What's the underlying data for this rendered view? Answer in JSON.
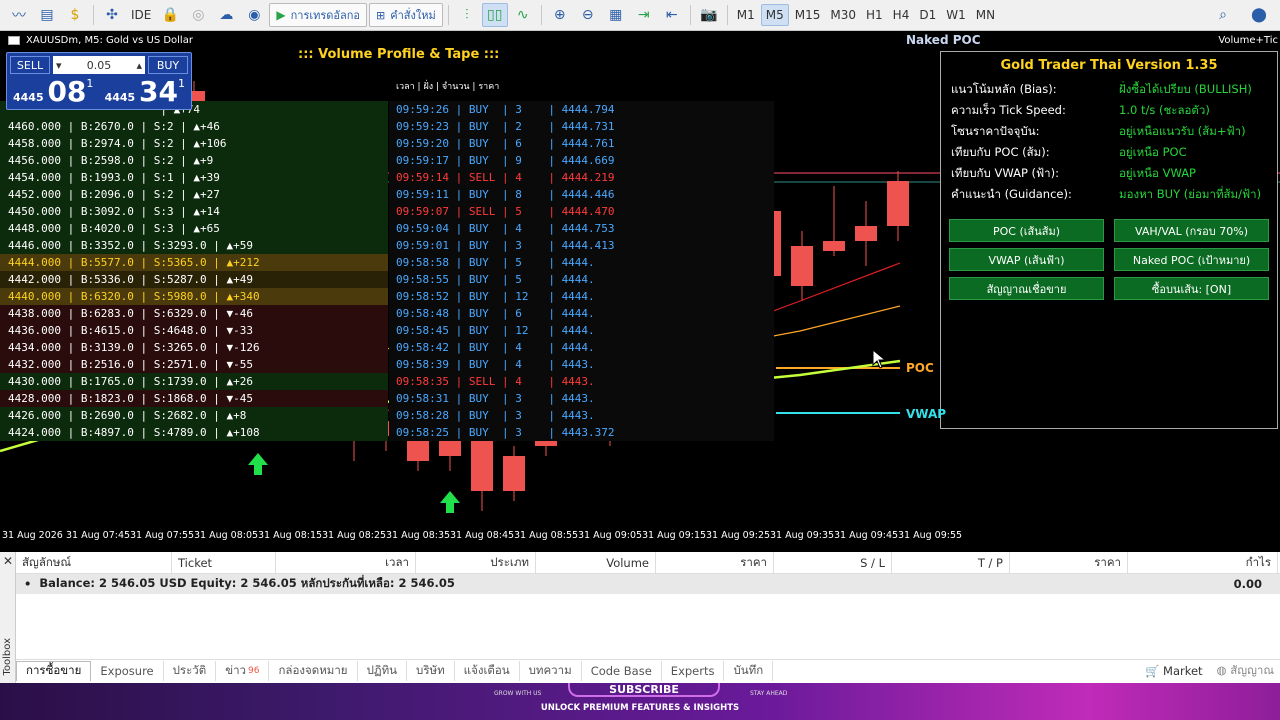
{
  "toolbar": {
    "algo_label": "การเทรดอัลกอ",
    "new_order_label": "คำสั่งใหม่",
    "ide_label": "IDE",
    "timeframes": [
      "M1",
      "M5",
      "M15",
      "M30",
      "H1",
      "H4",
      "D1",
      "W1",
      "MN"
    ],
    "active_timeframe": "M5"
  },
  "chart": {
    "title": "XAUUSDm, M5:  Gold vs US Dollar",
    "right_label": "Volume+Tic",
    "naked_poc_label": "Naked POC",
    "poc_label": "POC",
    "vwap_label": "VWAP",
    "time_labels": [
      "31 Aug 2026",
      "31 Aug 07:45",
      "31 Aug 07:55",
      "31 Aug 08:05",
      "31 Aug 08:15",
      "31 Aug 08:25",
      "31 Aug 08:35",
      "31 Aug 08:45",
      "31 Aug 08:55",
      "31 Aug 09:05",
      "31 Aug 09:15",
      "31 Aug 09:25",
      "31 Aug 09:35",
      "31 Aug 09:45",
      "31 Aug 09:55"
    ]
  },
  "trade_panel": {
    "sell_label": "SELL",
    "buy_label": "BUY",
    "lot": "0.05",
    "bid_prefix": "4445",
    "bid_main": "08",
    "bid_sup": "1",
    "ask_prefix": "4445",
    "ask_main": "34",
    "ask_sup": "1"
  },
  "volume_profile": {
    "title": "::: Volume Profile & Tape :::",
    "rows": [
      {
        "text": "                       | ▲+74",
        "bg": "#0c2a0c",
        "color": "#fff"
      },
      {
        "text": "4460.000 | B:2670.0 | S:2 | ▲+46",
        "bg": "#0c2a0c",
        "color": "#fff"
      },
      {
        "text": "4458.000 | B:2974.0 | S:2 | ▲+106",
        "bg": "#0c2a0c",
        "color": "#fff"
      },
      {
        "text": "4456.000 | B:2598.0 | S:2 | ▲+9",
        "bg": "#0c2a0c",
        "color": "#fff"
      },
      {
        "text": "4454.000 | B:1993.0 | S:1 | ▲+39",
        "bg": "#0c2a0c",
        "color": "#fff"
      },
      {
        "text": "4452.000 | B:2096.0 | S:2 | ▲+27",
        "bg": "#0c2a0c",
        "color": "#fff"
      },
      {
        "text": "4450.000 | B:3092.0 | S:3 | ▲+14",
        "bg": "#0c2a0c",
        "color": "#fff"
      },
      {
        "text": "4448.000 | B:4020.0 | S:3 | ▲+65",
        "bg": "#0c2a0c",
        "color": "#fff"
      },
      {
        "text": "4446.000 | B:3352.0 | S:3293.0 | ▲+59",
        "bg": "#0c2a0c",
        "color": "#fff"
      },
      {
        "text": "4444.000 | B:5577.0 | S:5365.0 | ▲+212",
        "bg": "#4a3a0c",
        "color": "#ffd21f"
      },
      {
        "text": "4442.000 | B:5336.0 | S:5287.0 | ▲+49",
        "bg": "#2a2206",
        "color": "#fff"
      },
      {
        "text": "4440.000 | B:6320.0 | S:5980.0 | ▲+340",
        "bg": "#4a3a0c",
        "color": "#ffd21f"
      },
      {
        "text": "4438.000 | B:6283.0 | S:6329.0 | ▼-46",
        "bg": "#2a0c0c",
        "color": "#fff"
      },
      {
        "text": "4436.000 | B:4615.0 | S:4648.0 | ▼-33",
        "bg": "#2a0c0c",
        "color": "#fff"
      },
      {
        "text": "4434.000 | B:3139.0 | S:3265.0 | ▼-126",
        "bg": "#2a0c0c",
        "color": "#fff"
      },
      {
        "text": "4432.000 | B:2516.0 | S:2571.0 | ▼-55",
        "bg": "#2a0c0c",
        "color": "#fff"
      },
      {
        "text": "4430.000 | B:1765.0 | S:1739.0 | ▲+26",
        "bg": "#0c2a0c",
        "color": "#fff"
      },
      {
        "text": "4428.000 | B:1823.0 | S:1868.0 | ▼-45",
        "bg": "#2a0c0c",
        "color": "#fff"
      },
      {
        "text": "4426.000 | B:2690.0 | S:2682.0 | ▲+8",
        "bg": "#0c2a0c",
        "color": "#fff"
      },
      {
        "text": "4424.000 | B:4897.0 | S:4789.0 | ▲+108",
        "bg": "#0c2a0c",
        "color": "#fff"
      }
    ]
  },
  "tape": {
    "header": "เวลา  | ฝั่ง  | จำนวน  | ราคา",
    "rows": [
      {
        "text": "09:59:26 | BUY  | 3    | 4444.794",
        "side": "buy"
      },
      {
        "text": "09:59:23 | BUY  | 2    | 4444.731",
        "side": "buy"
      },
      {
        "text": "09:59:20 | BUY  | 6    | 4444.761",
        "side": "buy"
      },
      {
        "text": "09:59:17 | BUY  | 9    | 4444.669",
        "side": "buy"
      },
      {
        "text": "09:59:14 | SELL | 4    | 4444.219",
        "side": "sell"
      },
      {
        "text": "09:59:11 | BUY  | 8    | 4444.446",
        "side": "buy"
      },
      {
        "text": "09:59:07 | SELL | 5    | 4444.470",
        "side": "sell"
      },
      {
        "text": "09:59:04 | BUY  | 4    | 4444.753",
        "side": "buy"
      },
      {
        "text": "09:59:01 | BUY  | 3    | 4444.413",
        "side": "buy"
      },
      {
        "text": "09:58:58 | BUY  | 5    | 4444.",
        "side": "buy"
      },
      {
        "text": "09:58:55 | BUY  | 5    | 4444.",
        "side": "buy"
      },
      {
        "text": "09:58:52 | BUY  | 12   | 4444.",
        "side": "buy"
      },
      {
        "text": "09:58:48 | BUY  | 6    | 4444.",
        "side": "buy"
      },
      {
        "text": "09:58:45 | BUY  | 12   | 4444.",
        "side": "buy"
      },
      {
        "text": "09:58:42 | BUY  | 4    | 4444.",
        "side": "buy"
      },
      {
        "text": "09:58:39 | BUY  | 4    | 4443.",
        "side": "buy"
      },
      {
        "text": "09:58:35 | SELL | 4    | 4443.",
        "side": "sell"
      },
      {
        "text": "09:58:31 | BUY  | 3    | 4443.",
        "side": "buy"
      },
      {
        "text": "09:58:28 | BUY  | 3    | 4443.",
        "side": "buy"
      },
      {
        "text": "09:58:25 | BUY  | 3    | 4443.372",
        "side": "buy"
      }
    ]
  },
  "gold_panel": {
    "title": "Gold Trader Thai Version 1.35",
    "rows": [
      {
        "k": "แนวโน้มหลัก (Bias):",
        "v": "ฝั่งซื้อได้เปรียบ (BULLISH)"
      },
      {
        "k": "ความเร็ว Tick Speed:",
        "v": "1.0 t/s (ชะลอตัว)"
      },
      {
        "k": "โซนราคาปัจจุบัน:",
        "v": "อยู่เหนือแนวรับ (ส้ม+ฟ้า)"
      },
      {
        "k": "เทียบกับ POC (ส้ม):",
        "v": "อยู่เหนือ POC"
      },
      {
        "k": "เทียบกับ VWAP (ฟ้า):",
        "v": "อยู่เหนือ VWAP"
      },
      {
        "k": "คำแนะนำ (Guidance):",
        "v": "มองหา BUY (ย่อมาที่ส้ม/ฟ้า)"
      }
    ],
    "buttons": [
      "POC (เส้นส้ม)",
      "VAH/VAL (กรอบ 70%)",
      "VWAP (เส้นฟ้า)",
      "Naked POC (เป้าหมาย)",
      "สัญญาณเชื่อขาย",
      "ซื้อบนเส้น: [ON]"
    ]
  },
  "toolbox": {
    "side_label": "Toolbox",
    "columns": [
      "สัญลักษณ์",
      "Ticket",
      "เวลา",
      "ประเภท",
      "Volume",
      "ราคา",
      "S / L",
      "T / P",
      "ราคา",
      "กำไร"
    ],
    "balance_text": "Balance: 2 546.05 USD  Equity: 2 546.05  หลักประกันที่เหลือ: 2 546.05",
    "profit": "0.00",
    "tabs": [
      "การซื้อขาย",
      "Exposure",
      "ประวัติ",
      "ข่าว",
      "กล่องจดหมาย",
      "ปฏิทิน",
      "บริษัท",
      "แจ้งเตือน",
      "บทความ",
      "Code Base",
      "Experts",
      "บันทึก"
    ],
    "news_badge": "96",
    "market_label": "Market",
    "signals_label": "สัญญาณ"
  },
  "banner": {
    "subscribe": "SUBSCRIBE",
    "unlock": "UNLOCK PREMIUM FEATURES & INSIGHTS",
    "grow": "GROW WITH US",
    "stay": "STAY AHEAD"
  },
  "colors": {
    "bull": "#26a69a",
    "bear": "#ef5350",
    "poc": "#ffa726",
    "vwap": "#34e1ea",
    "ma": "#c6ff3a"
  }
}
